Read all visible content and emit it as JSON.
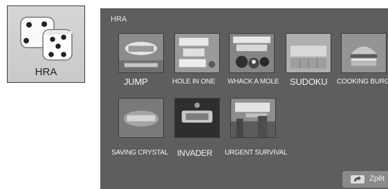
{
  "sidebar": {
    "card_label": "HRA",
    "card_icon": "dice-icon"
  },
  "panel": {
    "title": "HRA",
    "games": [
      {
        "name": "JUMP",
        "icon": "jump-game-icon"
      },
      {
        "name": "HOLE IN ONE",
        "icon": "hole-in-one-game-icon"
      },
      {
        "name": "WHACK A MOLE",
        "icon": "whack-a-mole-game-icon"
      },
      {
        "name": "SUDOKU",
        "icon": "sudoku-game-icon"
      },
      {
        "name": "COOKING BURGER",
        "icon": "cooking-burger-game-icon"
      },
      {
        "name": "SAVING CRYSTAL",
        "icon": "saving-crystal-game-icon"
      },
      {
        "name": "INVADER",
        "icon": "invader-game-icon"
      },
      {
        "name": "URGENT SURVIVAL",
        "icon": "urgent-survival-game-icon"
      }
    ],
    "back_label": "Zpět",
    "back_icon": "return-arrow-icon"
  },
  "colors": {
    "panel_bg": "#5e5e5e",
    "card_bg": "#d0d0d0",
    "text": "#f4f4f4"
  }
}
